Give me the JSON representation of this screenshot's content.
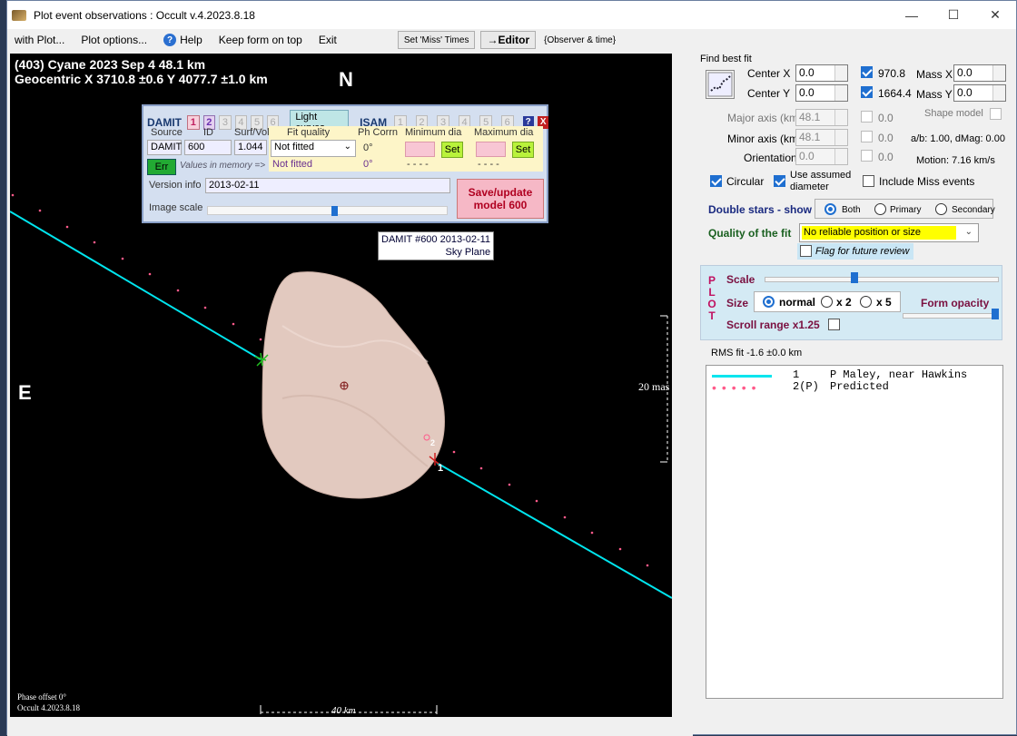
{
  "window": {
    "title": "Plot event observations : Occult v.4.2023.8.18",
    "controls": {
      "minimize": "—",
      "maximize": "☐",
      "close": "✕"
    }
  },
  "menu": {
    "with_plot": "with Plot...",
    "plot_options": "Plot options...",
    "help": "Help",
    "keep_form_on_top": "Keep form on top",
    "exit": "Exit",
    "set_miss_times": "Set 'Miss' Times",
    "editor": "→Editor",
    "observer_time": "{Observer & time}"
  },
  "plot": {
    "header_line1": "(403) Cyane  2023 Sep 4   48.1 km",
    "header_line2": "Geocentric  X  3710.8 ±0.6  Y 4077.7 ±1.0 km",
    "north": "N",
    "east": "E",
    "mas_label": "20 mas",
    "phase_offset": "Phase offset 0°",
    "version": "Occult 4.2023.8.18",
    "km_scale_label": "40 km",
    "damit_tag_line1": "DAMIT #600 2013-02-11",
    "damit_tag_line2": "Sky Plane",
    "chord_labels": [
      "1",
      "2"
    ]
  },
  "damit_panel": {
    "damit_label": "DAMIT",
    "damit_models": [
      "1",
      "2",
      "3",
      "4",
      "5",
      "6"
    ],
    "light_curves": "Light curves",
    "isam_label": "ISAM",
    "isam_models": [
      "1",
      "2",
      "3",
      "4",
      "5",
      "6"
    ],
    "help_btn": "?",
    "close_btn": "X",
    "col_source": "Source",
    "col_id": "ID",
    "col_surf_vol": "Surf/Vol",
    "col_fit_quality": "Fit quality",
    "col_ph_corrn": "Ph Corrn",
    "col_min_dia": "Minimum dia",
    "col_max_dia": "Maximum dia",
    "source": "DAMIT",
    "id": "600",
    "surf_vol": "1.044",
    "fit_quality_select": "Not fitted",
    "fit_quality_value": "Not fitted",
    "ph_corrn_1": "0°",
    "ph_corrn_2": "0°",
    "min_dia_dashes": "- - - -",
    "max_dia_dashes": "- - - -",
    "set_btn": "Set",
    "err_btn": "Err",
    "values_in_memory": "Values in memory =>",
    "version_info_label": "Version info",
    "version_info": "2013-02-11",
    "image_scale_label": "Image scale",
    "save_update_line1": "Save/update",
    "save_update_line2": "model 600"
  },
  "right_panel": {
    "find_best_fit": "Find best fit",
    "center_x_label": "Center X",
    "center_x": "0.0",
    "center_y_label": "Center Y",
    "center_y": "0.0",
    "val_970": "970.8",
    "val_1664": "1664.4",
    "mass_x_label": "Mass X",
    "mass_x": "0.0",
    "mass_y_label": "Mass Y",
    "mass_y": "0.0",
    "major_axis_label": "Major axis (km)",
    "major_axis": "48.1",
    "minor_axis_label": "Minor axis (km)",
    "minor_axis": "48.1",
    "orientation_label": "Orientation",
    "orientation": "0.0",
    "dis_val1": "0.0",
    "dis_val2": "0.0",
    "dis_val3": "0.0",
    "shape_model": "Shape model",
    "ab_dmag": "a/b: 1.00, dMag: 0.00",
    "motion": "Motion: 7.16 km/s",
    "circular": "Circular",
    "use_assumed_line1": "Use assumed",
    "use_assumed_line2": "diameter",
    "include_miss": "Include Miss events",
    "double_stars": "Double stars - show",
    "ds_both": "Both",
    "ds_primary": "Primary",
    "ds_secondary": "Secondary",
    "quality_label": "Quality of the fit",
    "quality_value": "No reliable position or size",
    "flag_review": "Flag for future review",
    "plot_word": [
      "P",
      "L",
      "O",
      "T"
    ],
    "scale_label": "Scale",
    "size_label": "Size",
    "size_normal": "normal",
    "size_x2": "x 2",
    "size_x5": "x 5",
    "form_opacity": "Form opacity",
    "scroll_range": "Scroll range x1.25",
    "rms_fit": "RMS fit -1.6 ±0.0 km",
    "legend": [
      {
        "num": "1",
        "text": "P Maley, near Hawkins"
      },
      {
        "num": "2(P)",
        "text": "Predicted"
      }
    ]
  },
  "colors": {
    "chord": "#00e5ee",
    "predicted": "#ff5a8a",
    "asteroid": "#e2c9bf"
  }
}
